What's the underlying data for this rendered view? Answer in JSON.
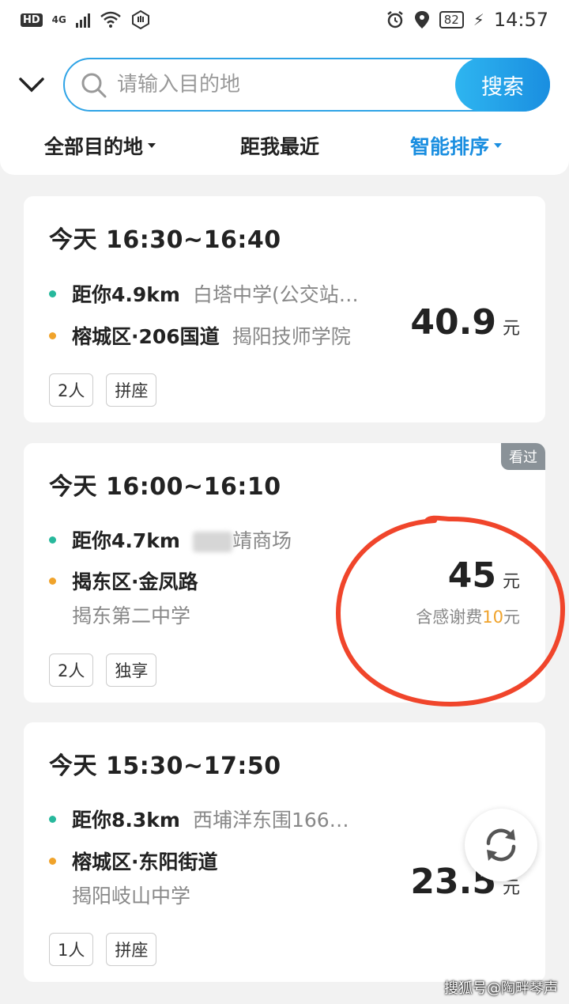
{
  "status_bar": {
    "hd": "HD",
    "network": "4G",
    "battery": "82",
    "time": "14:57"
  },
  "search": {
    "placeholder": "请输入目的地",
    "button_label": "搜索"
  },
  "filters": [
    {
      "label": "全部目的地"
    },
    {
      "label": "距我最近"
    },
    {
      "label": "智能排序"
    }
  ],
  "cards": [
    {
      "time_range": "今天 16:30~16:40",
      "pickup_main": "距你4.9km",
      "pickup_sub": "白塔中学(公交站…",
      "dest_main": "榕城区·206国道",
      "dest_sub": "揭阳技师学院",
      "price": "40.9",
      "unit": "元",
      "tags": [
        "2人",
        "拼座"
      ]
    },
    {
      "time_range": "今天 16:00~16:10",
      "badge": "看过",
      "pickup_main": "距你4.7km",
      "pickup_sub": "靖商场",
      "dest_main": "揭东区·金凤路",
      "dest_sub": "揭东第二中学",
      "price": "45",
      "unit": "元",
      "fee_prefix": "含感谢费",
      "fee_amount": "10",
      "fee_unit": "元",
      "tags": [
        "2人",
        "独享"
      ]
    },
    {
      "time_range": "今天 15:30~17:50",
      "pickup_main": "距你8.3km",
      "pickup_sub": "西埔洋东围166…",
      "dest_main": "榕城区·东阳街道",
      "dest_sub": "揭阳岐山中学",
      "price": "23.5",
      "unit": "元",
      "tags": [
        "1人",
        "拼座"
      ]
    }
  ],
  "watermark": "搜狐号@陶畔琴声",
  "colors": {
    "accent": "#1a8ee0",
    "green_dot": "#27b89c",
    "orange_dot": "#f0a32b",
    "annotation": "#f0452b"
  }
}
